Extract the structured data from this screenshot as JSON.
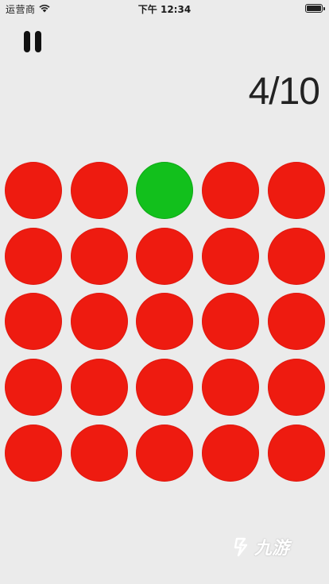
{
  "status_bar": {
    "carrier": "运营商",
    "time": "下午 12:34",
    "wifi_icon": "wifi-icon",
    "battery_icon": "battery-icon"
  },
  "game": {
    "pause_icon": "pause-icon",
    "score_text": "4/10",
    "grid": {
      "rows": 5,
      "cols": 5,
      "cells": [
        "red",
        "red",
        "green",
        "red",
        "red",
        "red",
        "red",
        "red",
        "red",
        "red",
        "red",
        "red",
        "red",
        "red",
        "red",
        "red",
        "red",
        "red",
        "red",
        "red",
        "red",
        "red",
        "red",
        "red",
        "red"
      ]
    },
    "colors": {
      "red": "#ee1b10",
      "green": "#12c01c",
      "background": "#ebebeb"
    }
  },
  "watermark": {
    "text": "九游"
  }
}
